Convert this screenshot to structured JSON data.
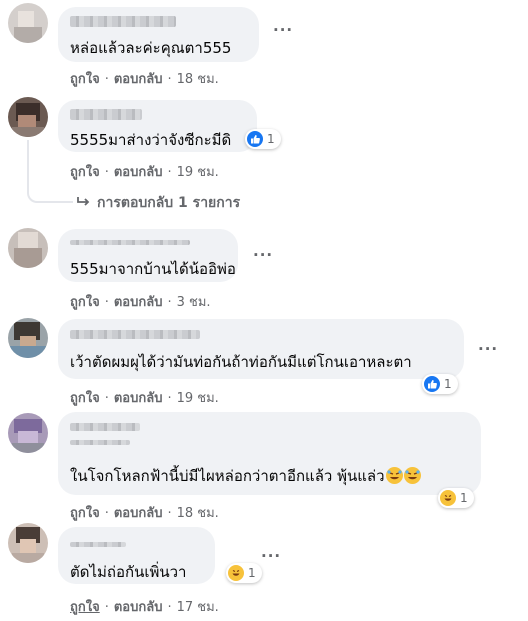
{
  "colors": {
    "bubble_bg": "#f0f2f5",
    "like_blue": "#1877f2",
    "haha_yellow": "#f7c23a",
    "meta_gray": "#65676b"
  },
  "comments": [
    {
      "text": "หล่อแล้วละค่ะคุณตา555",
      "like_label": "ถูกใจ",
      "reply_label": "ตอบกลับ",
      "time": "18 ชม."
    },
    {
      "text": "5555มาส่างว่าจังซีกะมีดิ",
      "like_label": "ถูกใจ",
      "reply_label": "ตอบกลับ",
      "time": "19 ชม.",
      "reaction": {
        "icon": "like-icon",
        "count": "1"
      },
      "replies_label": "การตอบกลับ 1 รายการ"
    },
    {
      "text": "555มาจากบ้านได้น้ออิพ่อ",
      "like_label": "ถูกใจ",
      "reply_label": "ตอบกลับ",
      "time": "3 ชม."
    },
    {
      "text": "เว้าตัดผมผุได้ว่ามันท่อกันถ้าท่อกันมีแต่โกนเอาหละตา",
      "like_label": "ถูกใจ",
      "reply_label": "ตอบกลับ",
      "time": "19 ชม.",
      "reaction": {
        "icon": "like-icon",
        "count": "1"
      }
    },
    {
      "text": "ในโจกโหลกฟ้านี้บ่มีไผหล่อกว่าตาอีกแล้ว พุ้นแล่ว",
      "like_label": "ถูกใจ",
      "reply_label": "ตอบกลับ",
      "time": "18 ชม.",
      "reaction": {
        "icon": "haha-icon",
        "count": "1"
      }
    },
    {
      "text": "ตัดไม่ถ่อกันเพิ่นวา",
      "like_label": "ถูกใจ",
      "reply_label": "ตอบกลับ",
      "time": "17 ชม.",
      "reaction": {
        "icon": "haha-icon",
        "count": "1"
      }
    }
  ],
  "separator": "·",
  "more_label": "···"
}
